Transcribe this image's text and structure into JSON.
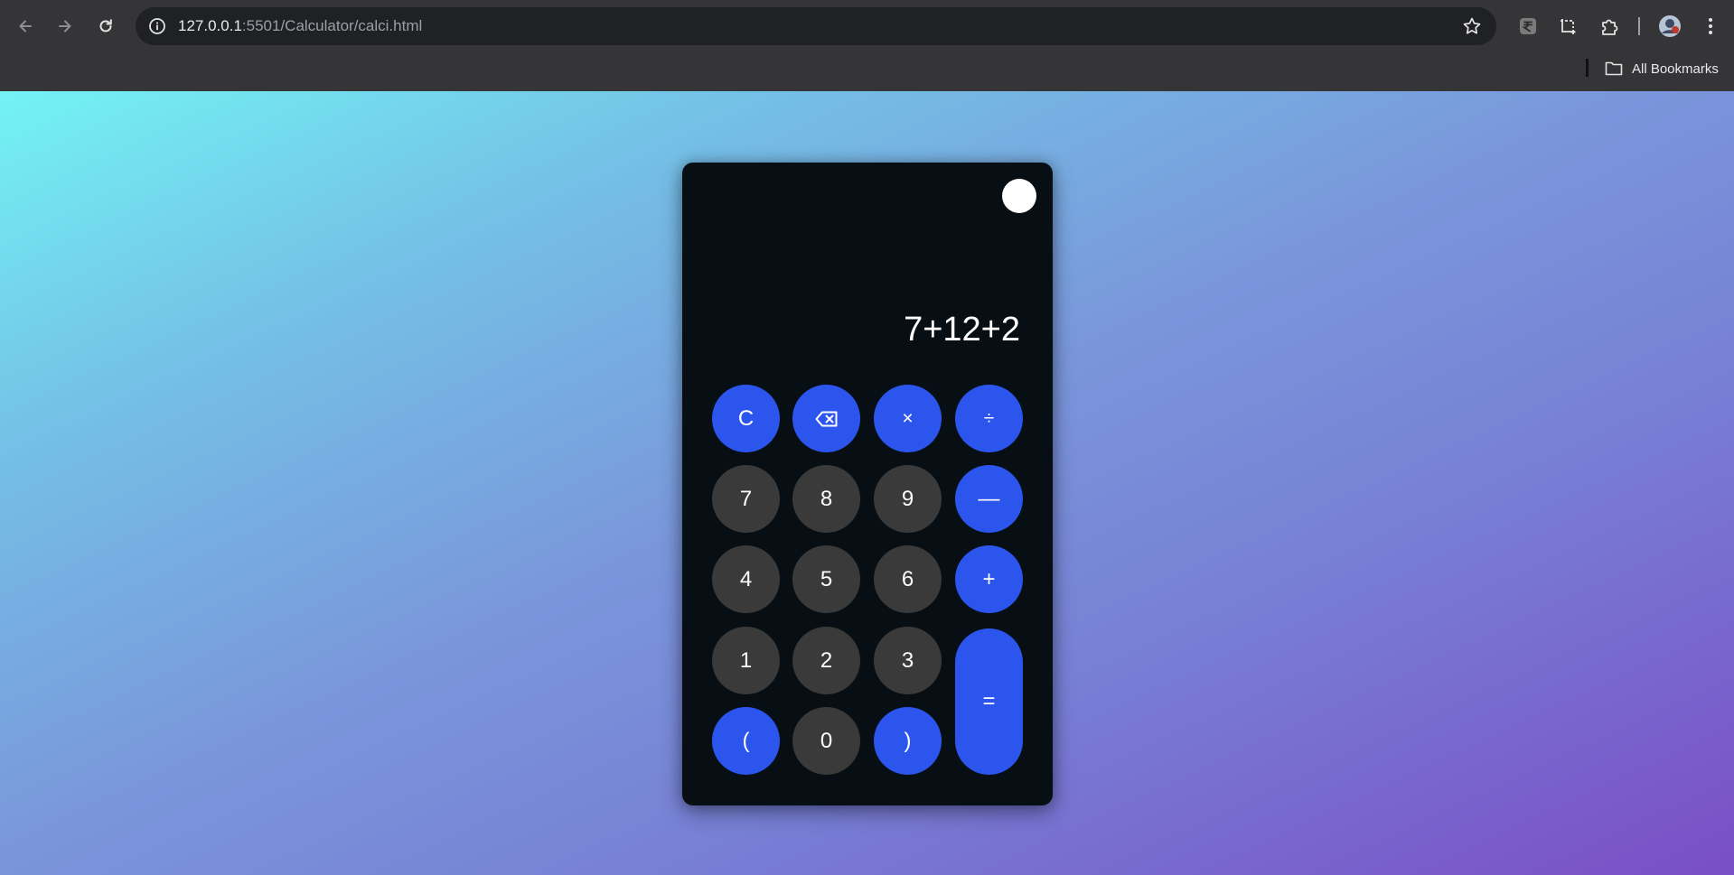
{
  "browser": {
    "url_host": "127.0.0.1",
    "url_rest": ":5501/Calculator/calci.html",
    "bookmarks_label": "All Bookmarks",
    "icons": [
      "back-arrow-icon",
      "forward-arrow-icon",
      "reload-icon",
      "site-info-icon",
      "bookmark-star-icon",
      "extension-rupee-icon",
      "screenshot-crop-icon",
      "extensions-puzzle-icon",
      "profile-avatar",
      "menu-kebab-icon",
      "folder-icon"
    ]
  },
  "calculator": {
    "display": "7+12+2",
    "colors": {
      "operator": "#2c55ee",
      "number": "#3a3a3a",
      "body": "#070f14",
      "toggle": "#ffffff"
    },
    "buttons": {
      "clear": "C",
      "backspace_icon": "backspace-icon",
      "multiply": "×",
      "divide": "÷",
      "seven": "7",
      "eight": "8",
      "nine": "9",
      "minus": "—",
      "four": "4",
      "five": "5",
      "six": "6",
      "plus": "+",
      "one": "1",
      "two": "2",
      "three": "3",
      "equals": "=",
      "open_paren": "(",
      "zero": "0",
      "close_paren": ")"
    }
  }
}
